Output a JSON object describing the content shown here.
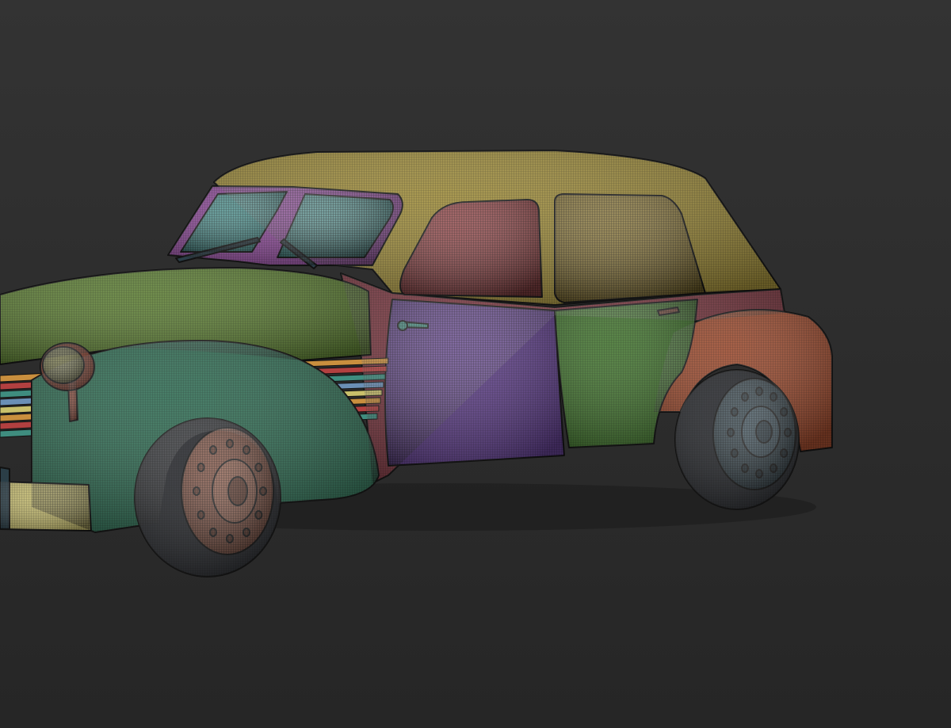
{
  "viewport": {
    "background_top": "#333333",
    "background_bottom": "#262626",
    "wire_color": "#000000"
  },
  "model": {
    "icon": "vintage-sedan-icon",
    "part_colors": {
      "roof": "#9c8a3a",
      "rear_window": "#8a7530",
      "rear_door_glass": "#8c3a3c",
      "windshield": "#3f8784",
      "windshield_frame": "#8b4a96",
      "hood": "#5c7d34",
      "front_fender": "#2f6b52",
      "front_door": "#5c3d86",
      "rear_door": "#42732f",
      "rear_fender": "#9a4a2e",
      "cowl": "#7a3740",
      "bumper": "#bfb66c",
      "headlight": "#6b6b3d",
      "headlight_ring": "#7a3a2a",
      "front_wheel_hub": "#7a4a3a",
      "rear_wheel_hub": "#2e3e46",
      "tire": "#25272b",
      "grille_stripes": [
        "#c98f3e",
        "#b24040",
        "#3f8d7f",
        "#6a8fb5",
        "#c9c06b"
      ]
    }
  }
}
